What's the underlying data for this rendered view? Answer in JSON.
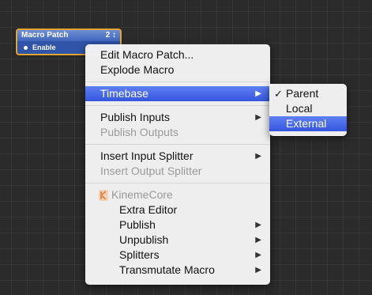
{
  "patch": {
    "title": "Macro Patch",
    "count": "2 ↕",
    "port_label": "Enable",
    "border_color": "#e2a633",
    "fill_color": "#2f54a8"
  },
  "menu": {
    "edit_macro": "Edit Macro Patch...",
    "explode_macro": "Explode Macro",
    "timebase": "Timebase",
    "publish_inputs": "Publish Inputs",
    "publish_outputs": "Publish Outputs",
    "insert_input_splitter": "Insert Input Splitter",
    "insert_output_splitter": "Insert Output Splitter",
    "section_title": "KinemeCore",
    "extra_editor": "Extra Editor",
    "publish": "Publish",
    "unpublish": "Unpublish",
    "splitters": "Splitters",
    "transmutate_macro": "Transmutate Macro",
    "arrow_glyph": "▶",
    "highlight_color": "#3b5ee6"
  },
  "submenu": {
    "parent": "Parent",
    "local": "Local",
    "external": "External",
    "checkmark": "✓"
  },
  "icons": [
    "submenu-arrow-icon",
    "checkmark-icon",
    "kineme-logo-icon",
    "port-dot-icon"
  ]
}
